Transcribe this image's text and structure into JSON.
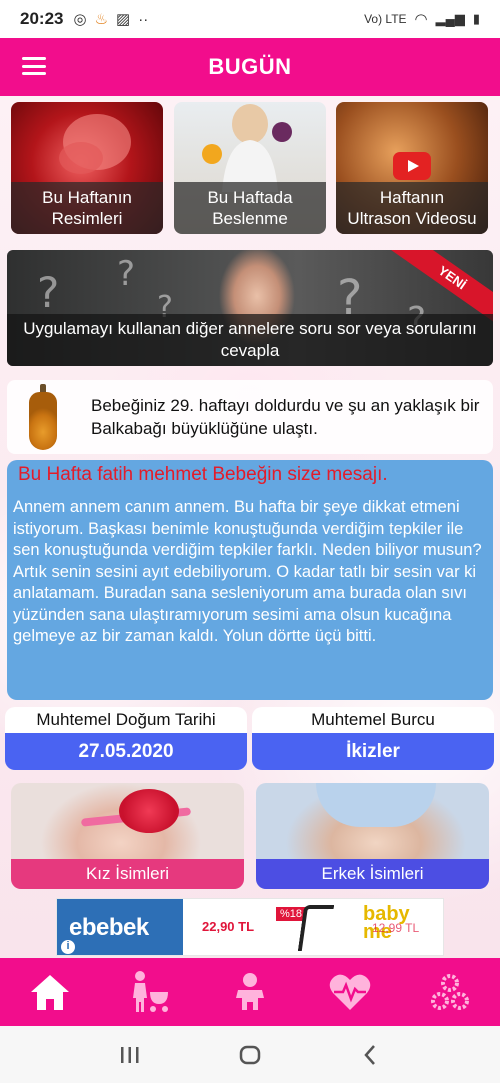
{
  "status_bar": {
    "time": "20:23",
    "network": "Vo) LTE"
  },
  "app_bar": {
    "title": "BUGÜN",
    "menu_icon": "hamburger-menu-icon"
  },
  "tiles": [
    {
      "label": "Bu Haftanın\nResimleri"
    },
    {
      "label": "Bu Haftada\nBeslenme"
    },
    {
      "label": "Haftanın\nUltrason Videosu"
    }
  ],
  "question_banner": {
    "label": "Uygulamayı kullanan diğer annelere soru sor veya sorularını cevapla",
    "ribbon": "YENİ"
  },
  "info": {
    "text": "Bebeğiniz 29. haftayı doldurdu ve şu an yaklaşık bir Balkabağı büyüklüğüne ulaştı."
  },
  "message": {
    "title": "Bu Hafta fatih mehmet Bebeğin size mesajı.",
    "body": "Annem annem canım annem. Bu hafta bir şeye dikkat etmeni istiyorum. Başkası benimle konuştuğunda verdiğim tepkiler ile sen konuştuğunda verdiğim tepkiler farklı. Neden biliyor musun? Artık senin sesini ayıt edebiliyorum. O kadar tatlı bir sesin var ki anlatamam. Buradan sana sesleniyorum ama burada olan sıvı yüzünden sana ulaştıramıyorum sesimi ama olsun kucağına gelmeye az bir zaman kaldı. Yolun dörtte üçü bitti."
  },
  "cards": {
    "due_date": {
      "label": "Muhtemel Doğum Tarihi",
      "value": "27.05.2020"
    },
    "zodiac": {
      "label": "Muhtemel Burcu",
      "value": "İkizler"
    }
  },
  "names": {
    "girl": "Kız İsimleri",
    "boy": "Erkek İsimleri"
  },
  "ad": {
    "brand": "ebebek",
    "price1": "22,90 TL",
    "discount": "%18",
    "brand2": "baby me",
    "price2": "12,99 TL"
  },
  "bottom_nav": [
    "home-icon",
    "mother-stroller-icon",
    "baby-icon",
    "heart-pulse-icon",
    "settings-gears-icon"
  ],
  "colors": {
    "primary": "#f20d8c",
    "message_bg": "#64a7e1",
    "message_title": "#e31c2a",
    "card_value_bg": "#4a63f2",
    "girl_label_bg": "#e6397e",
    "boy_label_bg": "#4c4ee3"
  }
}
